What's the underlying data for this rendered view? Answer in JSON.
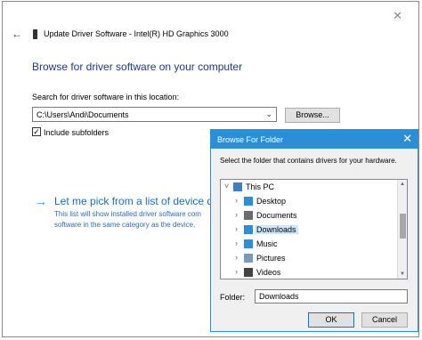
{
  "wizard": {
    "close_glyph": "✕",
    "back_glyph": "←",
    "title": "Update Driver Software - Intel(R) HD Graphics 3000",
    "heading": "Browse for driver software on your computer",
    "search_label": "Search for driver software in this location:",
    "path_value": "C:\\Users\\Andi\\Documents",
    "combo_arrow": "⌄",
    "browse_label": "Browse...",
    "include_subfolders_checked": true,
    "check_glyph": "✓",
    "include_subfolders_label": "Include subfolders",
    "pick_arrow": "→",
    "pick_title": "Let me pick from a list of device driv",
    "pick_desc_line1": "This list will show installed driver software com",
    "pick_desc_line2": "software in the same category as the device."
  },
  "dialog": {
    "title": "Browse For Folder",
    "close_glyph": "✕",
    "prompt": "Select the folder that contains drivers for your hardware.",
    "tree": [
      {
        "label": "This PC",
        "expander": "˅",
        "icon": "computer-icon",
        "color": "#3c7fc7",
        "level": 0,
        "selected": false
      },
      {
        "label": "Desktop",
        "expander": "›",
        "icon": "desktop-folder-icon",
        "color": "#2b8fd8",
        "level": 1,
        "selected": false
      },
      {
        "label": "Documents",
        "expander": "›",
        "icon": "documents-folder-icon",
        "color": "#6b6b6b",
        "level": 1,
        "selected": false
      },
      {
        "label": "Downloads",
        "expander": "›",
        "icon": "downloads-folder-icon",
        "color": "#2b8fd8",
        "level": 1,
        "selected": true
      },
      {
        "label": "Music",
        "expander": "›",
        "icon": "music-folder-icon",
        "color": "#2b8fd8",
        "level": 1,
        "selected": false
      },
      {
        "label": "Pictures",
        "expander": "›",
        "icon": "pictures-folder-icon",
        "color": "#7a9bb8",
        "level": 1,
        "selected": false
      },
      {
        "label": "Videos",
        "expander": "›",
        "icon": "videos-folder-icon",
        "color": "#444",
        "level": 1,
        "selected": false
      }
    ],
    "folder_label": "Folder:",
    "folder_value": "Downloads",
    "ok_label": "OK",
    "cancel_label": "Cancel",
    "scroll_up": "▲",
    "scroll_down": "▼"
  },
  "colors": {
    "accent": "#2b8fd8",
    "heading": "#1e3a8a",
    "link": "#1e6fb8",
    "selection": "#cce8ff"
  }
}
